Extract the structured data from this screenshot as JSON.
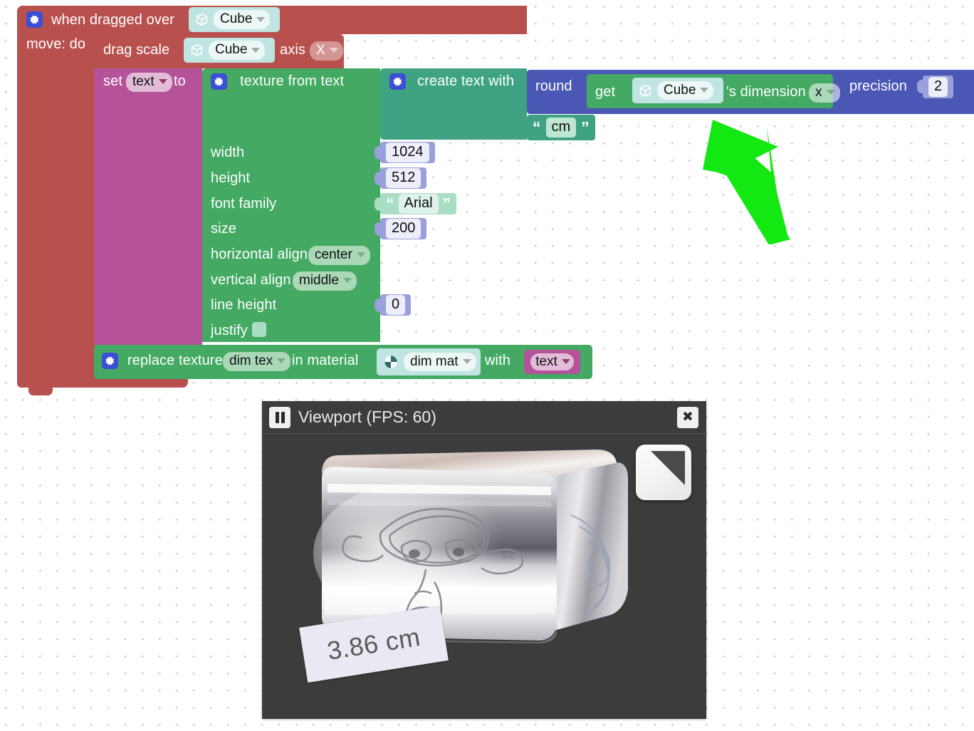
{
  "workspace": {
    "grid": "dotted-cross-grid",
    "background_color": "#ffffff"
  },
  "colors": {
    "event_block": "#b8504e",
    "variable_block": "#b5529a",
    "texture_block": "#43a963",
    "text_block": "#3fa383",
    "math_block": "#4a57b5",
    "number_field": "#9aa0dc",
    "string_field": "#a9ddc4",
    "object_field": "#bfe4e2",
    "annotation_arrow": "#13e813",
    "panel_chrome": "#3c3c3c"
  },
  "blocks": {
    "event": {
      "label": "when dragged over",
      "object_label": "Cube",
      "statement_label": "move: do",
      "icon": "gear-icon",
      "object_icon": "cube-icon"
    },
    "drag_scale": {
      "label": "drag scale",
      "object_label": "Cube",
      "axis_label": "axis",
      "axis_value": "X",
      "object_icon": "cube-icon"
    },
    "set_variable": {
      "label_before": "set",
      "variable": "text",
      "label_after": "to"
    },
    "texture_from_text": {
      "title": "texture from text",
      "icon": "gear-icon",
      "fields": [
        {
          "label": "width",
          "value": "1024",
          "kind": "number"
        },
        {
          "label": "height",
          "value": "512",
          "kind": "number"
        },
        {
          "label": "font family",
          "value": "Arial",
          "kind": "string"
        },
        {
          "label": "size",
          "value": "200",
          "kind": "number"
        },
        {
          "label": "horizontal align",
          "value": "center",
          "kind": "dropdown"
        },
        {
          "label": "vertical align",
          "value": "middle",
          "kind": "dropdown"
        },
        {
          "label": "line height",
          "value": "0",
          "kind": "number"
        },
        {
          "label": "justify",
          "value": "",
          "kind": "checkbox"
        }
      ]
    },
    "create_text_with": {
      "title": "create text with",
      "icon": "gear-icon",
      "string_item": "cm"
    },
    "round": {
      "label": "round",
      "precision_label": "precision",
      "precision_value": "2"
    },
    "get_dimension": {
      "label": "get",
      "object_label": "Cube",
      "object_icon": "cube-icon",
      "suffix_label": "'s dimension",
      "axis_value": "x"
    },
    "replace_texture": {
      "icon": "gear-icon",
      "label": "replace texture",
      "texture_value": "dim tex",
      "material_label": "in material",
      "material_value": "dim mat",
      "material_icon": "material-sphere-icon",
      "with_label": "with",
      "with_value": "text"
    }
  },
  "viewport": {
    "title": "Viewport (FPS: 60)",
    "fps": "60",
    "pause_icon": "pause-icon",
    "close_icon": "close-icon",
    "close_label": "✖",
    "gizmo": "view-orientation-gizmo",
    "object_label": "3.86 cm"
  },
  "annotation": {
    "arrow": "green-arrow-up-left"
  }
}
